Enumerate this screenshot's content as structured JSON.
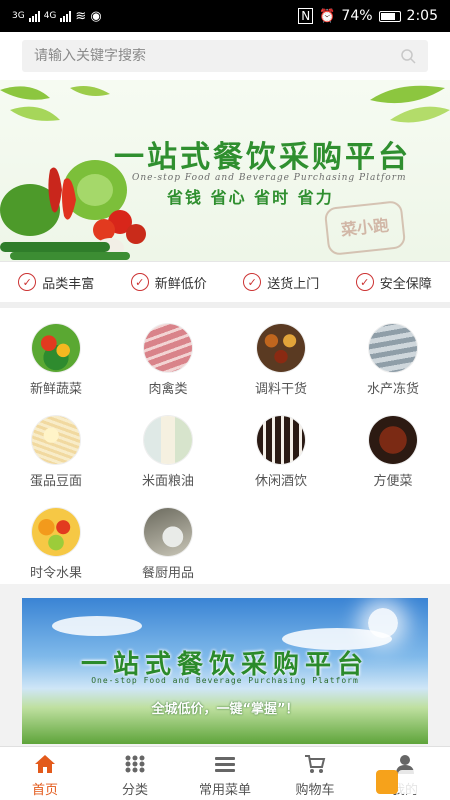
{
  "status_bar": {
    "network_left": "3G",
    "network_right": "4G",
    "battery": "74%",
    "time": "2:05"
  },
  "search": {
    "placeholder": "请输入关键字搜索"
  },
  "banner": {
    "title": "一站式餐饮采购平台",
    "subtitle": "One-stop Food and Beverage Purchasing Platform",
    "slogan": "省钱 省心 省时 省力",
    "stamp": "菜小跑"
  },
  "features": [
    {
      "label": "品类丰富"
    },
    {
      "label": "新鲜低价"
    },
    {
      "label": "送货上门"
    },
    {
      "label": "安全保障"
    }
  ],
  "categories": [
    {
      "label": "新鲜蔬菜",
      "icon": "vegetables-icon"
    },
    {
      "label": "肉禽类",
      "icon": "meat-icon"
    },
    {
      "label": "调料干货",
      "icon": "spices-icon"
    },
    {
      "label": "水产冻货",
      "icon": "seafood-icon"
    },
    {
      "label": "蛋品豆面",
      "icon": "eggs-noodles-icon"
    },
    {
      "label": "米面粮油",
      "icon": "rice-oil-icon"
    },
    {
      "label": "休闲酒饮",
      "icon": "drinks-icon"
    },
    {
      "label": "方便菜",
      "icon": "prepared-dish-icon"
    },
    {
      "label": "时令水果",
      "icon": "fruit-icon"
    },
    {
      "label": "餐厨用品",
      "icon": "kitchenware-icon"
    }
  ],
  "promo_banner": {
    "title": "一站式餐饮采购平台",
    "subtitle": "One-stop Food and Beverage Purchasing Platform",
    "slogan": "全城低价，一键“掌握”！"
  },
  "tabbar": [
    {
      "label": "首页",
      "icon": "home-icon",
      "active": true
    },
    {
      "label": "分类",
      "icon": "grid-icon",
      "active": false
    },
    {
      "label": "常用菜单",
      "icon": "list-icon",
      "active": false
    },
    {
      "label": "购物车",
      "icon": "cart-icon",
      "active": false
    },
    {
      "label": "我的",
      "icon": "user-icon",
      "active": false
    }
  ],
  "colors": {
    "accent": "#e35a1b",
    "brand_green": "#2f8f2f",
    "check_red": "#cc3333"
  }
}
